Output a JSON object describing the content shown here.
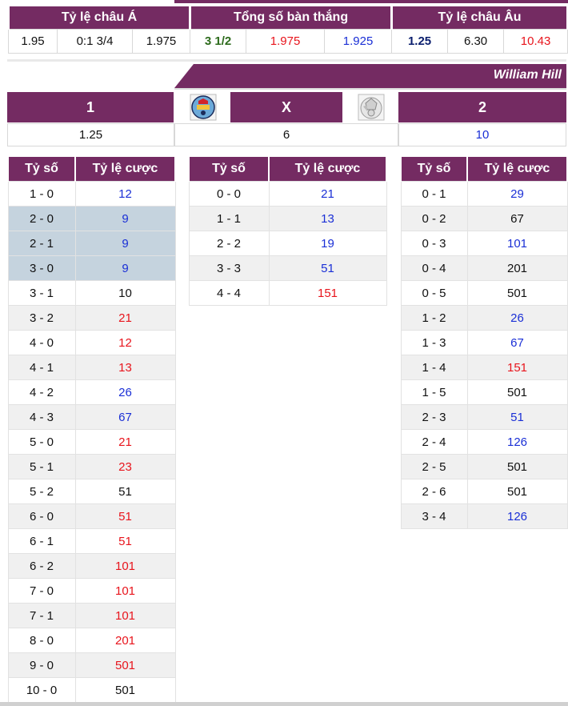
{
  "summary": {
    "headers": [
      "Tỷ lệ châu Á",
      "Tổng số bàn thắng",
      "Tỷ lệ châu Âu"
    ],
    "values": [
      {
        "text": "1.95",
        "color": "black"
      },
      {
        "text": "0:1 3/4",
        "color": "black"
      },
      {
        "text": "1.975",
        "color": "black"
      },
      {
        "text": "3 1/2",
        "color": "green"
      },
      {
        "text": "1.975",
        "color": "red"
      },
      {
        "text": "1.925",
        "color": "blue"
      },
      {
        "text": "1.25",
        "color": "navy"
      },
      {
        "text": "6.30",
        "color": "black"
      },
      {
        "text": "10.43",
        "color": "red"
      }
    ]
  },
  "bookmaker": "William Hill",
  "result_odds": {
    "home_label": "1",
    "draw_label": "X",
    "away_label": "2",
    "home_value": "1.25",
    "draw_value": "6",
    "away_value": "10",
    "home_logo_icon": "manchester-city-crest-icon",
    "away_logo_icon": "crystal-palace-crest-icon"
  },
  "score_tables": {
    "col_score": "Tỷ số",
    "col_odds": "Tỷ lệ cược",
    "home_wins": [
      {
        "score": "1 - 0",
        "odds": "12",
        "color": "blue",
        "hl": false
      },
      {
        "score": "2 - 0",
        "odds": "9",
        "color": "blue",
        "hl": true
      },
      {
        "score": "2 - 1",
        "odds": "9",
        "color": "blue",
        "hl": true
      },
      {
        "score": "3 - 0",
        "odds": "9",
        "color": "blue",
        "hl": true
      },
      {
        "score": "3 - 1",
        "odds": "10",
        "color": "black",
        "hl": false
      },
      {
        "score": "3 - 2",
        "odds": "21",
        "color": "red",
        "hl": false
      },
      {
        "score": "4 - 0",
        "odds": "12",
        "color": "red",
        "hl": false
      },
      {
        "score": "4 - 1",
        "odds": "13",
        "color": "red",
        "hl": false
      },
      {
        "score": "4 - 2",
        "odds": "26",
        "color": "blue",
        "hl": false
      },
      {
        "score": "4 - 3",
        "odds": "67",
        "color": "blue",
        "hl": false
      },
      {
        "score": "5 - 0",
        "odds": "21",
        "color": "red",
        "hl": false
      },
      {
        "score": "5 - 1",
        "odds": "23",
        "color": "red",
        "hl": false
      },
      {
        "score": "5 - 2",
        "odds": "51",
        "color": "black",
        "hl": false
      },
      {
        "score": "6 - 0",
        "odds": "51",
        "color": "red",
        "hl": false
      },
      {
        "score": "6 - 1",
        "odds": "51",
        "color": "red",
        "hl": false
      },
      {
        "score": "6 - 2",
        "odds": "101",
        "color": "red",
        "hl": false
      },
      {
        "score": "7 - 0",
        "odds": "101",
        "color": "red",
        "hl": false
      },
      {
        "score": "7 - 1",
        "odds": "101",
        "color": "red",
        "hl": false
      },
      {
        "score": "8 - 0",
        "odds": "201",
        "color": "red",
        "hl": false
      },
      {
        "score": "9 - 0",
        "odds": "501",
        "color": "red",
        "hl": false
      },
      {
        "score": "10 - 0",
        "odds": "501",
        "color": "black",
        "hl": false
      }
    ],
    "draws": [
      {
        "score": "0 - 0",
        "odds": "21",
        "color": "blue",
        "hl": false
      },
      {
        "score": "1 - 1",
        "odds": "13",
        "color": "blue",
        "hl": false
      },
      {
        "score": "2 - 2",
        "odds": "19",
        "color": "blue",
        "hl": false
      },
      {
        "score": "3 - 3",
        "odds": "51",
        "color": "blue",
        "hl": false
      },
      {
        "score": "4 - 4",
        "odds": "151",
        "color": "red",
        "hl": false
      }
    ],
    "away_wins": [
      {
        "score": "0 - 1",
        "odds": "29",
        "color": "blue",
        "hl": false
      },
      {
        "score": "0 - 2",
        "odds": "67",
        "color": "black",
        "hl": false
      },
      {
        "score": "0 - 3",
        "odds": "101",
        "color": "blue",
        "hl": false
      },
      {
        "score": "0 - 4",
        "odds": "201",
        "color": "black",
        "hl": false
      },
      {
        "score": "0 - 5",
        "odds": "501",
        "color": "black",
        "hl": false
      },
      {
        "score": "1 - 2",
        "odds": "26",
        "color": "blue",
        "hl": false
      },
      {
        "score": "1 - 3",
        "odds": "67",
        "color": "blue",
        "hl": false
      },
      {
        "score": "1 - 4",
        "odds": "151",
        "color": "red",
        "hl": false
      },
      {
        "score": "1 - 5",
        "odds": "501",
        "color": "black",
        "hl": false
      },
      {
        "score": "2 - 3",
        "odds": "51",
        "color": "blue",
        "hl": false
      },
      {
        "score": "2 - 4",
        "odds": "126",
        "color": "blue",
        "hl": false
      },
      {
        "score": "2 - 5",
        "odds": "501",
        "color": "black",
        "hl": false
      },
      {
        "score": "2 - 6",
        "odds": "501",
        "color": "black",
        "hl": false
      },
      {
        "score": "3 - 4",
        "odds": "126",
        "color": "blue",
        "hl": false
      }
    ]
  }
}
